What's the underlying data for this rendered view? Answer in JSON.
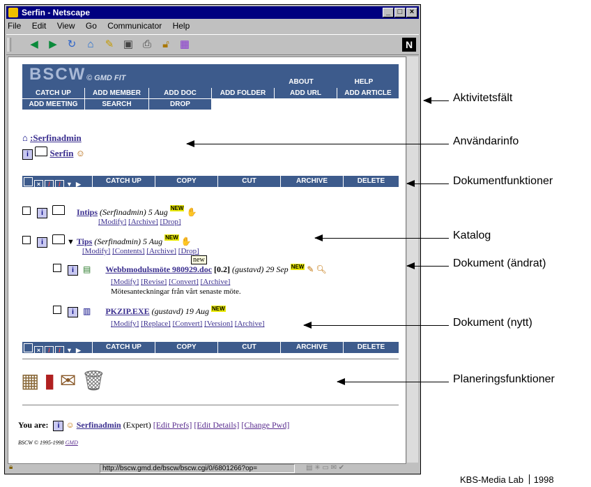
{
  "window": {
    "title": "Serfin - Netscape",
    "menu": [
      "File",
      "Edit",
      "View",
      "Go",
      "Communicator",
      "Help"
    ],
    "status_url": "http://bscw.gmd.de/bscw/bscw.cgi/0/6801266?op="
  },
  "banner": {
    "logo": "BSCW",
    "copyright": "© GMD FIT",
    "about": "ABOUT",
    "help": "HELP",
    "row1": [
      "CATCH UP",
      "ADD MEMBER",
      "ADD DOC",
      "ADD FOLDER",
      "ADD URL",
      "ADD ARTICLE"
    ],
    "row2": [
      "ADD MEETING",
      "SEARCH",
      "DROP"
    ]
  },
  "path": {
    "user": ":Serfinadmin",
    "folder": "Serfin"
  },
  "actions": [
    "CATCH UP",
    "COPY",
    "CUT",
    "ARCHIVE",
    "DELETE"
  ],
  "items": {
    "intips": {
      "name": "Intips",
      "meta": "(Serfinadmin) 5 Aug",
      "links": [
        "[Modify]",
        "[Archive]",
        "[Drop]"
      ]
    },
    "tips": {
      "name": "Tips",
      "meta": "(Serfinadmin) 5 Aug",
      "links": [
        "[Modify]",
        "[Contents]",
        "[Archive]",
        "[Drop]"
      ]
    },
    "webb": {
      "name": "Webbmodulsmöte 980929.doc",
      "version": "[0.2]",
      "meta": "(gustavd) 29 Sep",
      "links": [
        "[Modify]",
        "[Revise]",
        "[Convert]",
        "[Archive]"
      ],
      "desc": "Mötesanteckningar från vårt senaste möte.",
      "tooltip": "new"
    },
    "pkzip": {
      "name": "PKZIP.EXE",
      "meta": "(gustavd) 19 Aug",
      "links": [
        "[Modify]",
        "[Replace]",
        "[Convert]",
        "[Version]",
        "[Archive]"
      ]
    }
  },
  "new_badge": "NEW",
  "you_are": {
    "label": "You are:",
    "user": "Serfinadmin",
    "role": "(Expert)",
    "links": [
      "[Edit Prefs]",
      "[Edit Details]",
      "[Change Pwd]"
    ],
    "copyright": "BSCW © 1995-1998",
    "gmd": "GMD"
  },
  "annotations": [
    "Aktivitetsfält",
    "Användarinfo",
    "Dokumentfunktioner",
    "Katalog",
    "Dokument (ändrat)",
    "Dokument (nytt)",
    "Planeringsfunktioner"
  ],
  "footer": "KBS-Media Lab",
  "footer_year": "1998",
  "colors": {
    "banner": "#3d5b8c",
    "titlebar": "#000080"
  }
}
